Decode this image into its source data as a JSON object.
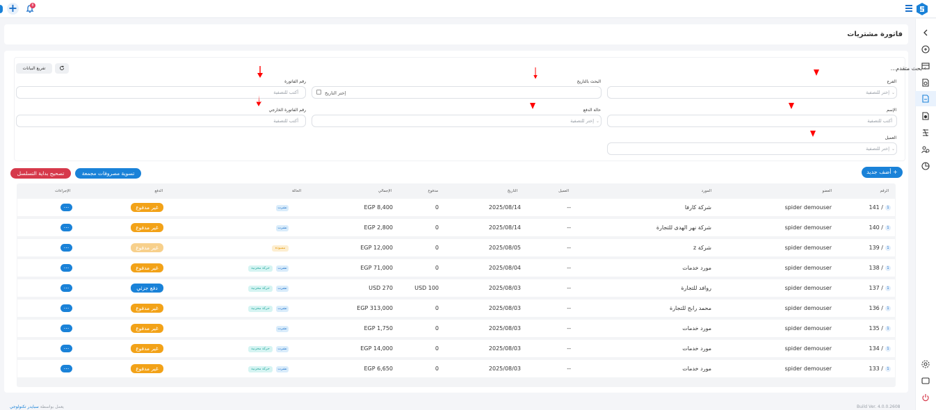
{
  "topbar": {
    "notification_count": "8"
  },
  "header": {
    "title": "فاتورة مشتريات"
  },
  "filters": {
    "advanced_search": "بحث متقدم...",
    "clear_label": "تفريغ البيانات",
    "branch_label": "الفرع",
    "branch_placeholder": "إختر للتصفية",
    "date_label": "البحث بالتاريخ",
    "date_placeholder": "إختر التاريخ",
    "invoice_no_label": "رقم الفاتورة",
    "invoice_no_placeholder": "أكتب للتصفية",
    "name_label": "الإسم",
    "name_placeholder": "أكتب للتصفية",
    "payment_status_label": "حالة الدفع",
    "payment_status_placeholder": "إختر للتصفية",
    "ext_invoice_label": "رقم الفاتورة الخارجي",
    "ext_invoice_placeholder": "أكتب للتصفية",
    "client_label": "العميل",
    "client_placeholder": "إختر للتصفية"
  },
  "actions": {
    "add_new": "+ أضف جديد",
    "settle": "تسوية مصروفات مجمعة",
    "fix_sequence": "تصحيح بداية التسلسل"
  },
  "table": {
    "headers": {
      "number": "الرقم",
      "member": "العضو",
      "supplier": "المورد",
      "client": "العميل",
      "date": "التاريخ",
      "paid": "مدفوع",
      "total": "الإجمالي",
      "status": "الحالة",
      "payment": "الدفع",
      "actions": "الإجراءات"
    },
    "rows": [
      {
        "num": "141 /",
        "member": "spider demouser",
        "supplier": "شركة كارفا",
        "client": "--",
        "date": "2025/08/14",
        "paid": "0",
        "total": "EGP 8,400",
        "tags": [
          "نشرت"
        ],
        "payment": "غير مدفوع",
        "pay_style": "orange"
      },
      {
        "num": "140 /",
        "member": "spider demouser",
        "supplier": "شركة  نهر الهدى للتجارة",
        "client": "--",
        "date": "2025/08/14",
        "paid": "0",
        "total": "EGP 2,800",
        "tags": [
          "نشرت"
        ],
        "payment": "غير مدفوع",
        "pay_style": "orange"
      },
      {
        "num": "139 /",
        "member": "spider demouser",
        "supplier": "شركة z",
        "client": "--",
        "date": "2025/08/05",
        "paid": "0",
        "total": "EGP 12,000",
        "tags": [
          "مسودة"
        ],
        "payment": "غير مدفوع",
        "pay_style": "faded"
      },
      {
        "num": "138 /",
        "member": "spider demouser",
        "supplier": "مورد خدمات",
        "client": "--",
        "date": "2025/08/04",
        "paid": "0",
        "total": "EGP 71,000",
        "tags": [
          "نشرت",
          "حركة مخزنية"
        ],
        "payment": "غير مدفوع",
        "pay_style": "orange"
      },
      {
        "num": "137 /",
        "member": "spider demouser",
        "supplier": "روافد للتجارة",
        "client": "--",
        "date": "2025/08/03",
        "paid": "USD 100",
        "total": "USD 270",
        "tags": [
          "نشرت",
          "حركة مخزنية"
        ],
        "payment": "دفع جزئي",
        "pay_style": "blue"
      },
      {
        "num": "136 /",
        "member": "spider demouser",
        "supplier": "محمد رابح للتجارة",
        "client": "--",
        "date": "2025/08/03",
        "paid": "0",
        "total": "EGP 313,000",
        "tags": [
          "نشرت",
          "حركة مخزنية"
        ],
        "payment": "غير مدفوع",
        "pay_style": "orange"
      },
      {
        "num": "135 /",
        "member": "spider demouser",
        "supplier": "مورد خدمات",
        "client": "--",
        "date": "2025/08/03",
        "paid": "0",
        "total": "EGP 1,750",
        "tags": [
          "نشرت"
        ],
        "payment": "غير مدفوع",
        "pay_style": "orange"
      },
      {
        "num": "134 /",
        "member": "spider demouser",
        "supplier": "مورد خدمات",
        "client": "--",
        "date": "2025/08/03",
        "paid": "0",
        "total": "EGP 14,000",
        "tags": [
          "نشرت",
          "حركة مخزنية"
        ],
        "payment": "غير مدفوع",
        "pay_style": "orange"
      },
      {
        "num": "133 /",
        "member": "spider demouser",
        "supplier": "مورد خدمات",
        "client": "--",
        "date": "2025/08/03",
        "paid": "0",
        "total": "EGP 6,650",
        "tags": [
          "نشرت",
          "حركة مخزنية"
        ],
        "payment": "غير مدفوع",
        "pay_style": "orange"
      }
    ],
    "row_badge": "1",
    "dots": "..."
  },
  "footer": {
    "powered_prefix": "يعمل بواسطة",
    "powered_by": "سبايدر تكنولوجي",
    "version": "Build Ver. 4.0.0.2608"
  },
  "colors": {
    "primary": "#1a82d8",
    "danger": "#d6394b",
    "unpaid": "#f2a218",
    "annotation_arrow": "#ff0000"
  },
  "icons": [
    "logo-icon",
    "menu-icon",
    "plus-icon",
    "bell-icon",
    "chevron-left-icon",
    "refresh-icon",
    "calendar-icon",
    "gear-icon",
    "display-icon",
    "power-icon"
  ]
}
